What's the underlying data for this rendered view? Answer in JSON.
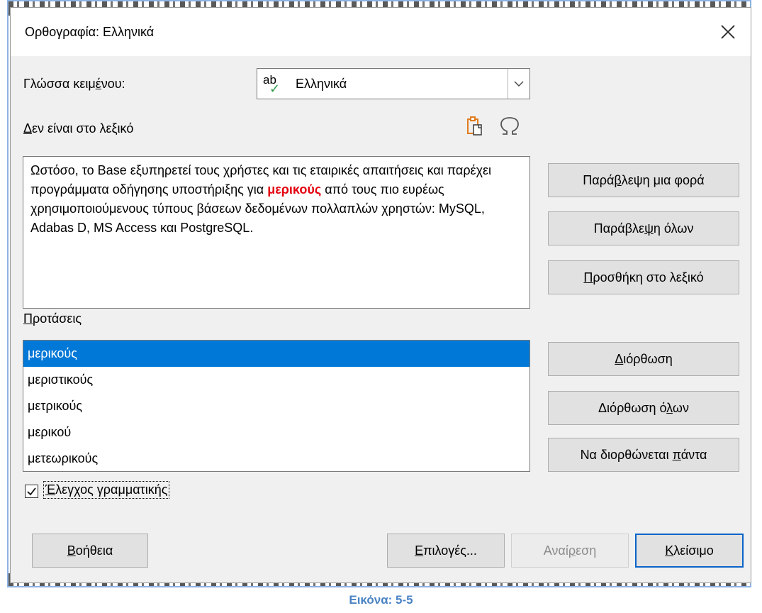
{
  "dialog": {
    "title": "Ορθογραφία: Ελληνικά",
    "close_glyph": "✕"
  },
  "language": {
    "label": "Γλώσσα κειμένου:",
    "selected": "Ελληνικά",
    "icon": "ab"
  },
  "not_in_dictionary": {
    "label": "Δεν είναι στο λεξικό",
    "text_before": "Ωστόσο, το Base εξυπηρετεί τους χρήστες και τις εταιρικές απαιτήσεις και παρέχει προγράμματα οδήγησης υποστήριξης  για ",
    "error_word": "μερικούς",
    "text_after": " από τους πιο ευρέως χρησιμοποιούμενους τύπους βάσεων δεδομένων πολλαπλών χρηστών: MySQL, Adabas D, MS Access και PostgreSQL."
  },
  "side_buttons": {
    "ignore_once": "Παράβλεψη μια φορά",
    "ignore_all": "Παράβλεψη όλων",
    "add_to_dictionary": "Προσθήκη στο λεξικό",
    "correct": "Διόρθωση",
    "correct_all": "Διόρθωση όλων",
    "always_correct": "Να διορθώνεται πάντα"
  },
  "suggestions": {
    "label": "Προτάσεις",
    "items": [
      "μερικούς",
      "μεριστικούς",
      "μετρικούς",
      "μερικού",
      "μετεωρικούς"
    ],
    "selected_index": 0
  },
  "grammar": {
    "label": "Έλεγχος γραμματικής",
    "checked": true
  },
  "bottom_buttons": {
    "help": "Βοήθεια",
    "options": "Επιλογές...",
    "undo": "Αναίρεση",
    "close": "Κλείσιμο"
  },
  "caption": "Εικόνα: 5-5",
  "colors": {
    "error_text": "#e3000f",
    "selection": "#0078d7",
    "caption": "#4a83c4",
    "frame": "#8db3e2"
  }
}
